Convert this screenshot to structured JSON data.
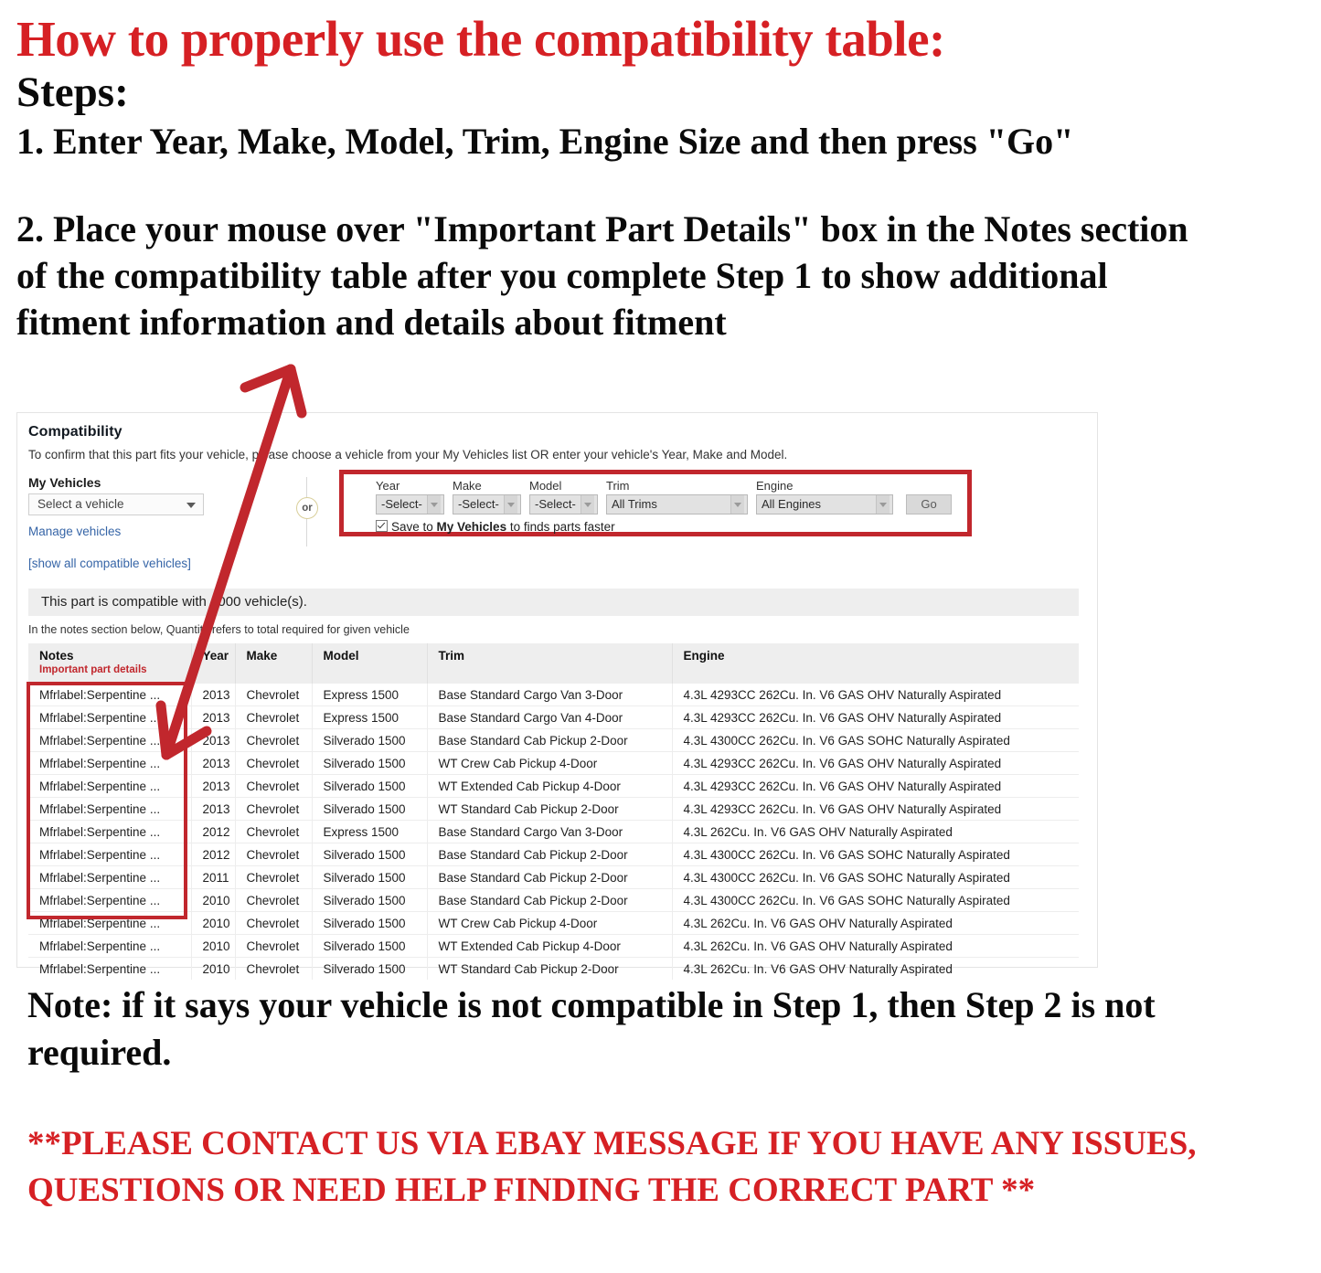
{
  "colors": {
    "headline_red": "#D62024",
    "box_red": "#C1272D",
    "link_blue": "#3665a7",
    "notes_red": "#C1272D"
  },
  "instructions": {
    "headline": "How to properly use the compatibility table:",
    "steps_label": "Steps:",
    "step1": "1. Enter Year, Make, Model, Trim, Engine Size and then press \"Go\"",
    "step2": "2. Place your mouse over \"Important Part Details\" box in the Notes section of the compatibility table after you complete Step 1 to show additional fitment information and details about fitment"
  },
  "compat": {
    "title": "Compatibility",
    "subtitle": "To confirm that this part fits your vehicle, please choose a vehicle from your My Vehicles list OR enter your vehicle's Year, Make and Model.",
    "my_vehicles_label": "My Vehicles",
    "vehicle_select_value": "Select a vehicle",
    "manage_vehicles_link": "Manage vehicles",
    "show_all_link": "[show all compatible vehicles]",
    "or_label": "or",
    "finder": {
      "year_label": "Year",
      "year_value": "-Select-",
      "make_label": "Make",
      "make_value": "-Select-",
      "model_label": "Model",
      "model_value": "-Select-",
      "trim_label": "Trim",
      "trim_value": "All Trims",
      "engine_label": "Engine",
      "engine_value": "All Engines",
      "go_label": "Go"
    },
    "save_checkbox": {
      "prefix": "Save to ",
      "strong": "My Vehicles",
      "suffix": " to finds parts faster",
      "checked": true
    },
    "banner": "This part is compatible with 1000 vehicle(s).",
    "notes_hint": "In the notes section below, Quantity refers to total required for given vehicle"
  },
  "table": {
    "headers": {
      "notes": "Notes",
      "notes_sub": "Important part details",
      "year": "Year",
      "make": "Make",
      "model": "Model",
      "trim": "Trim",
      "engine": "Engine"
    },
    "rows": [
      {
        "notes": "Mfrlabel:Serpentine ...",
        "year": "2013",
        "make": "Chevrolet",
        "model": "Express 1500",
        "trim": "Base Standard Cargo Van 3-Door",
        "engine": "4.3L 4293CC 262Cu. In. V6 GAS OHV Naturally Aspirated"
      },
      {
        "notes": "Mfrlabel:Serpentine ...",
        "year": "2013",
        "make": "Chevrolet",
        "model": "Express 1500",
        "trim": "Base Standard Cargo Van 4-Door",
        "engine": "4.3L 4293CC 262Cu. In. V6 GAS OHV Naturally Aspirated"
      },
      {
        "notes": "Mfrlabel:Serpentine ...",
        "year": "2013",
        "make": "Chevrolet",
        "model": "Silverado 1500",
        "trim": "Base Standard Cab Pickup 2-Door",
        "engine": "4.3L 4300CC 262Cu. In. V6 GAS SOHC Naturally Aspirated"
      },
      {
        "notes": "Mfrlabel:Serpentine ...",
        "year": "2013",
        "make": "Chevrolet",
        "model": "Silverado 1500",
        "trim": "WT Crew Cab Pickup 4-Door",
        "engine": "4.3L 4293CC 262Cu. In. V6 GAS OHV Naturally Aspirated"
      },
      {
        "notes": "Mfrlabel:Serpentine ...",
        "year": "2013",
        "make": "Chevrolet",
        "model": "Silverado 1500",
        "trim": "WT Extended Cab Pickup 4-Door",
        "engine": "4.3L 4293CC 262Cu. In. V6 GAS OHV Naturally Aspirated"
      },
      {
        "notes": "Mfrlabel:Serpentine ...",
        "year": "2013",
        "make": "Chevrolet",
        "model": "Silverado 1500",
        "trim": "WT Standard Cab Pickup 2-Door",
        "engine": "4.3L 4293CC 262Cu. In. V6 GAS OHV Naturally Aspirated"
      },
      {
        "notes": "Mfrlabel:Serpentine ...",
        "year": "2012",
        "make": "Chevrolet",
        "model": "Express 1500",
        "trim": "Base Standard Cargo Van 3-Door",
        "engine": "4.3L 262Cu. In. V6 GAS OHV Naturally Aspirated"
      },
      {
        "notes": "Mfrlabel:Serpentine ...",
        "year": "2012",
        "make": "Chevrolet",
        "model": "Silverado 1500",
        "trim": "Base Standard Cab Pickup 2-Door",
        "engine": "4.3L 4300CC 262Cu. In. V6 GAS SOHC Naturally Aspirated"
      },
      {
        "notes": "Mfrlabel:Serpentine ...",
        "year": "2011",
        "make": "Chevrolet",
        "model": "Silverado 1500",
        "trim": "Base Standard Cab Pickup 2-Door",
        "engine": "4.3L 4300CC 262Cu. In. V6 GAS SOHC Naturally Aspirated"
      },
      {
        "notes": "Mfrlabel:Serpentine ...",
        "year": "2010",
        "make": "Chevrolet",
        "model": "Silverado 1500",
        "trim": "Base Standard Cab Pickup 2-Door",
        "engine": "4.3L 4300CC 262Cu. In. V6 GAS SOHC Naturally Aspirated"
      },
      {
        "notes": "Mfrlabel:Serpentine ...",
        "year": "2010",
        "make": "Chevrolet",
        "model": "Silverado 1500",
        "trim": "WT Crew Cab Pickup 4-Door",
        "engine": "4.3L 262Cu. In. V6 GAS OHV Naturally Aspirated"
      },
      {
        "notes": "Mfrlabel:Serpentine ...",
        "year": "2010",
        "make": "Chevrolet",
        "model": "Silverado 1500",
        "trim": "WT Extended Cab Pickup 4-Door",
        "engine": "4.3L 262Cu. In. V6 GAS OHV Naturally Aspirated"
      },
      {
        "notes": "Mfrlabel:Serpentine ...",
        "year": "2010",
        "make": "Chevrolet",
        "model": "Silverado 1500",
        "trim": "WT Standard Cab Pickup 2-Door",
        "engine": "4.3L 262Cu. In. V6 GAS OHV Naturally Aspirated"
      }
    ]
  },
  "footer": {
    "note": "Note: if it says your vehicle is not compatible in Step 1, then Step 2 is not required.",
    "contact": "**PLEASE CONTACT US VIA EBAY MESSAGE IF YOU HAVE ANY ISSUES, QUESTIONS OR NEED HELP FINDING THE CORRECT PART **"
  }
}
